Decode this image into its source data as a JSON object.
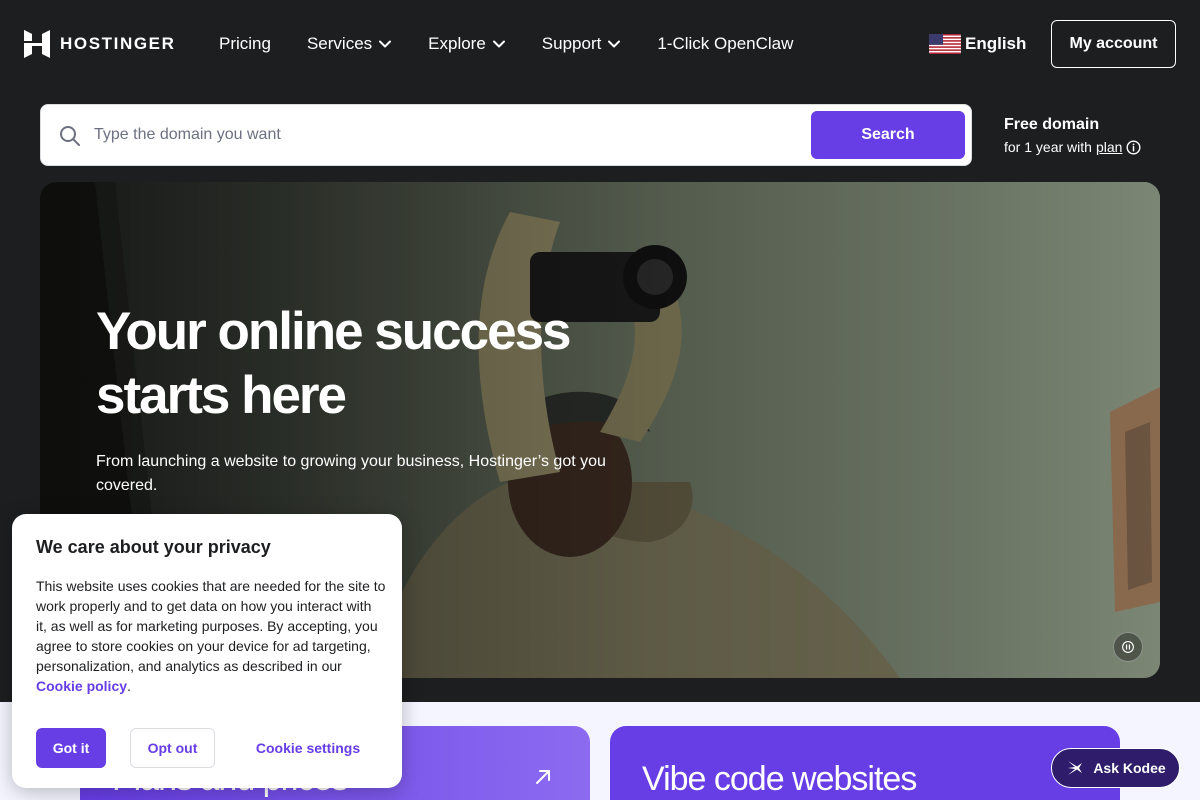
{
  "header": {
    "logo_text": "HOSTINGER",
    "nav": [
      {
        "label": "Pricing",
        "has_dropdown": false
      },
      {
        "label": "Services",
        "has_dropdown": true
      },
      {
        "label": "Explore",
        "has_dropdown": true
      },
      {
        "label": "Support",
        "has_dropdown": true
      },
      {
        "label": "1-Click OpenClaw",
        "has_dropdown": false
      }
    ],
    "language": {
      "label": "English",
      "flag_icon": "us-flag-icon"
    },
    "account_label": "My account"
  },
  "search": {
    "placeholder": "Type the domain you want",
    "value": "",
    "button_label": "Search",
    "promo_title": "Free domain",
    "promo_sub_prefix": "for 1 year with",
    "promo_link": "plan"
  },
  "hero": {
    "title_line1": "Your online success",
    "title_line2": "starts here",
    "subtitle": "From launching a website to growing your business, Hostinger’s got you covered.",
    "media_control_icon": "pause-icon"
  },
  "cards": [
    {
      "title": "Plans and prices",
      "icon": "arrow-up-right-icon"
    },
    {
      "title": "Vibe code websites"
    }
  ],
  "cookie": {
    "title": "We care about your privacy",
    "body": "This website uses cookies that are needed for the site to work properly and to get data on how you interact with it, as well as for marketing purposes. By accepting, you agree to store cookies on your device for ad targeting, personalization, and analytics as described in our",
    "link": "Cookie policy",
    "link_suffix": ".",
    "accept_label": "Got it",
    "optout_label": "Opt out",
    "settings_label": "Cookie settings"
  },
  "assistant": {
    "label": "Ask Kodee"
  },
  "colors": {
    "background": "#1d1e20",
    "brand_purple": "#673de6",
    "light_section": "#f4f5ff",
    "text_dark": "#1d1e20"
  }
}
